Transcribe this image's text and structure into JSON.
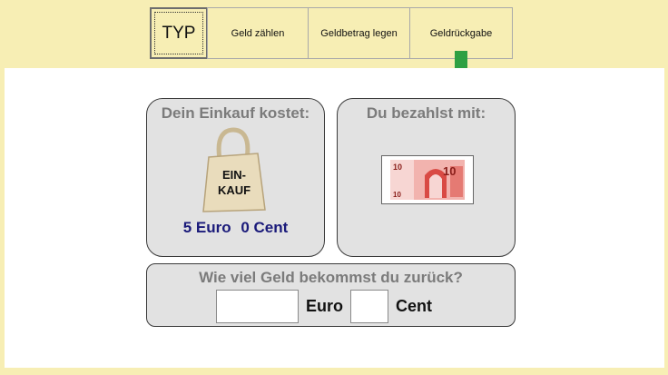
{
  "tabs": [
    {
      "label": "TYP"
    },
    {
      "label": "Geld zählen"
    },
    {
      "label": "Geldbetrag legen"
    },
    {
      "label": "Geldrückgabe"
    }
  ],
  "purchase": {
    "title": "Dein Einkauf kostet:",
    "bag_text_line1": "EIN-",
    "bag_text_line2": "KAUF",
    "euro_text": "5 Euro",
    "cent_text": "0 Cent"
  },
  "payment": {
    "title": "Du bezahlst mit:",
    "note_denomination": "10"
  },
  "question": {
    "title": "Wie viel Geld bekommst du zurück?",
    "euro_value": "",
    "euro_unit": "Euro",
    "cent_value": "",
    "cent_unit": "Cent"
  },
  "colors": {
    "background": "#f7eeb4",
    "arrow": "#2ea043",
    "price_text": "#1a1a7a",
    "box_title": "#7b7b7b"
  }
}
